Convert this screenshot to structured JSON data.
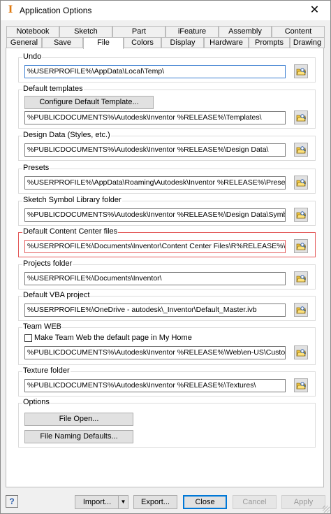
{
  "window": {
    "title": "Application Options",
    "app_icon": "inventor-icon",
    "close_glyph": "✕"
  },
  "tabs": {
    "back_row": [
      "Notebook",
      "Sketch",
      "Part",
      "iFeature",
      "Assembly",
      "Content Center"
    ],
    "front_row": [
      "General",
      "Save",
      "File",
      "Colors",
      "Display",
      "Hardware",
      "Prompts",
      "Drawing"
    ],
    "active": "File"
  },
  "groups": {
    "undo": {
      "label": "Undo",
      "path": "%USERPROFILE%\\AppData\\Local\\Temp\\"
    },
    "default_templates": {
      "label": "Default templates",
      "configure_button": "Configure Default Template...",
      "path": "%PUBLICDOCUMENTS%\\Autodesk\\Inventor %RELEASE%\\Templates\\"
    },
    "design_data": {
      "label": "Design Data (Styles, etc.)",
      "path": "%PUBLICDOCUMENTS%\\Autodesk\\Inventor %RELEASE%\\Design Data\\"
    },
    "presets": {
      "label": "Presets",
      "path": "%USERPROFILE%\\AppData\\Roaming\\Autodesk\\Inventor %RELEASE%\\Presets\\"
    },
    "sketch_symbol": {
      "label": "Sketch Symbol Library folder",
      "path": "%PUBLICDOCUMENTS%\\Autodesk\\Inventor %RELEASE%\\Design Data\\Symbol Library\\"
    },
    "content_center": {
      "label": "Default Content Center files",
      "path": "%USERPROFILE%\\Documents\\Inventor\\Content Center Files\\R%RELEASE%\\"
    },
    "projects": {
      "label": "Projects folder",
      "path": "%USERPROFILE%\\Documents\\Inventor\\"
    },
    "vba": {
      "label": "Default VBA project",
      "path": "%USERPROFILE%\\OneDrive - autodesk\\_Inventor\\Default_Master.ivb"
    },
    "team_web": {
      "label": "Team WEB",
      "checkbox_label": "Make Team Web the default page in My Home",
      "checked": false,
      "path": "%PUBLICDOCUMENTS%\\Autodesk\\Inventor %RELEASE%\\Web\\en-US\\CustomHelpSample.htm"
    },
    "texture": {
      "label": "Texture folder",
      "path": "%PUBLICDOCUMENTS%\\Autodesk\\Inventor %RELEASE%\\Textures\\"
    },
    "options": {
      "label": "Options",
      "file_open_button": "File Open...",
      "file_naming_button": "File Naming Defaults..."
    }
  },
  "footer": {
    "help": "?",
    "import": "Import...",
    "import_arrow": "▼",
    "export": "Export...",
    "close": "Close",
    "cancel": "Cancel",
    "apply": "Apply"
  },
  "colors": {
    "highlight_border": "#e35b5b",
    "focus_border": "#3c7fd1",
    "default_button_border": "#0078d7"
  }
}
